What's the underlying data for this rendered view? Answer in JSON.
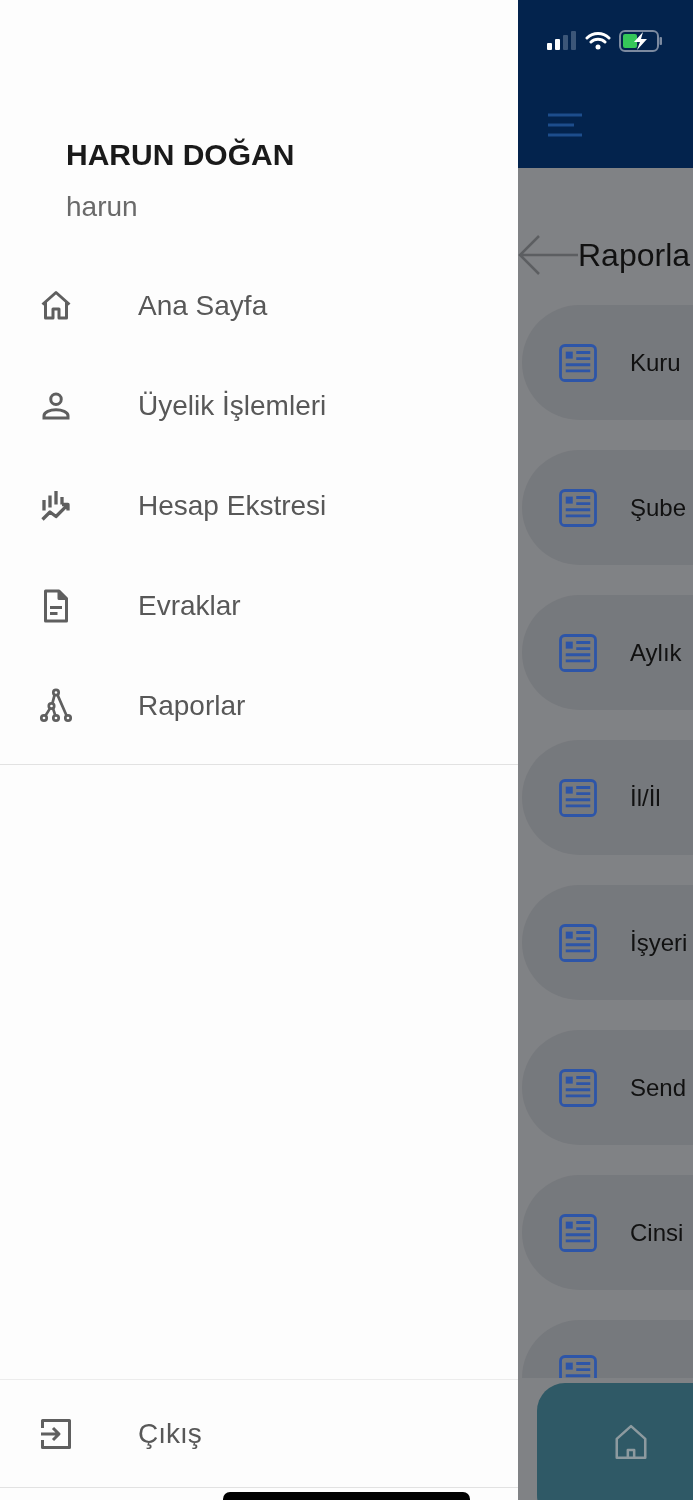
{
  "drawer": {
    "user": {
      "name": "HARUN DOĞAN",
      "username": "harun"
    },
    "menu": [
      {
        "label": "Ana Sayfa"
      },
      {
        "label": "Üyelik İşlemleri"
      },
      {
        "label": "Hesap Ekstresi"
      },
      {
        "label": "Evraklar"
      },
      {
        "label": "Raporlar"
      }
    ],
    "logout": {
      "label": "Çıkış"
    }
  },
  "background_screen": {
    "title": "Raporla",
    "cards": [
      {
        "label": "Kuru"
      },
      {
        "label": "Şube"
      },
      {
        "label": "Aylık"
      },
      {
        "label": "İl/İl"
      },
      {
        "label": "İşyeri"
      },
      {
        "label": "Send"
      },
      {
        "label": "Cinsi"
      }
    ]
  }
}
